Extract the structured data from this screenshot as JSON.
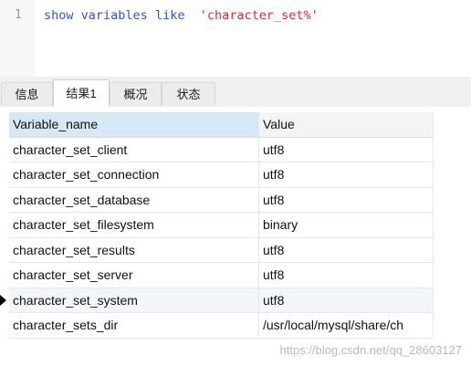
{
  "editor": {
    "line_number": "1",
    "kw_show": "show",
    "kw_variables": "variables",
    "kw_like": "like",
    "string_literal": "'character_set%'"
  },
  "tabs": [
    {
      "label": "信息",
      "active": false
    },
    {
      "label": "结果1",
      "active": true
    },
    {
      "label": "概况",
      "active": false
    },
    {
      "label": "状态",
      "active": false
    }
  ],
  "grid": {
    "columns": [
      "Variable_name",
      "Value"
    ],
    "rows": [
      [
        "character_set_client",
        "utf8"
      ],
      [
        "character_set_connection",
        "utf8"
      ],
      [
        "character_set_database",
        "utf8"
      ],
      [
        "character_set_filesystem",
        "binary"
      ],
      [
        "character_set_results",
        "utf8"
      ],
      [
        "character_set_server",
        "utf8"
      ],
      [
        "character_set_system",
        "utf8"
      ],
      [
        "character_sets_dir",
        "/usr/local/mysql/share/ch"
      ]
    ],
    "current_row_index": 6
  },
  "watermark": "https://blog.csdn.net/qq_28603127"
}
